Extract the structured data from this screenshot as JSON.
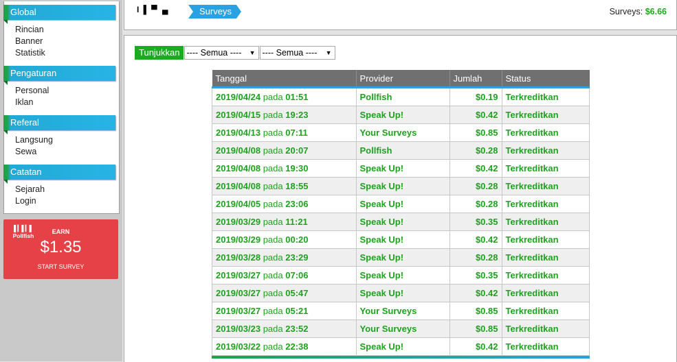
{
  "sidebar": {
    "groups": [
      {
        "title": "Global",
        "items": [
          "Rincian",
          "Banner",
          "Statistik"
        ]
      },
      {
        "title": "Pengaturan",
        "items": [
          "Personal",
          "Iklan"
        ]
      },
      {
        "title": "Referal",
        "items": [
          "Langsung",
          "Sewa"
        ]
      },
      {
        "title": "Catatan",
        "items": [
          "Sejarah",
          "Login"
        ]
      }
    ]
  },
  "ad": {
    "logo": "Pollfish",
    "earn": "EARN",
    "amount": "$1.35",
    "cta": "START SURVEY"
  },
  "breadcrumb": {
    "user": "I▐ ▀ ▄",
    "current": "Surveys"
  },
  "balance": {
    "label": "Surveys:",
    "value": "$6.66"
  },
  "filter": {
    "button": "Tunjukkan",
    "select1": "---- Semua ----",
    "select2": "---- Semua ----"
  },
  "table": {
    "headers": [
      "Tanggal",
      "Provider",
      "Jumlah",
      "Status"
    ],
    "pada": "pada",
    "rows": [
      {
        "date": "2019/04/24",
        "time": "01:51",
        "provider": "Pollfish",
        "amount": "$0.19",
        "status": "Terkreditkan"
      },
      {
        "date": "2019/04/15",
        "time": "19:23",
        "provider": "Speak Up!",
        "amount": "$0.42",
        "status": "Terkreditkan"
      },
      {
        "date": "2019/04/13",
        "time": "07:11",
        "provider": "Your Surveys",
        "amount": "$0.85",
        "status": "Terkreditkan"
      },
      {
        "date": "2019/04/08",
        "time": "20:07",
        "provider": "Pollfish",
        "amount": "$0.28",
        "status": "Terkreditkan"
      },
      {
        "date": "2019/04/08",
        "time": "19:30",
        "provider": "Speak Up!",
        "amount": "$0.42",
        "status": "Terkreditkan"
      },
      {
        "date": "2019/04/08",
        "time": "18:55",
        "provider": "Speak Up!",
        "amount": "$0.28",
        "status": "Terkreditkan"
      },
      {
        "date": "2019/04/05",
        "time": "23:06",
        "provider": "Speak Up!",
        "amount": "$0.28",
        "status": "Terkreditkan"
      },
      {
        "date": "2019/03/29",
        "time": "11:21",
        "provider": "Speak Up!",
        "amount": "$0.35",
        "status": "Terkreditkan"
      },
      {
        "date": "2019/03/29",
        "time": "00:20",
        "provider": "Speak Up!",
        "amount": "$0.42",
        "status": "Terkreditkan"
      },
      {
        "date": "2019/03/28",
        "time": "23:29",
        "provider": "Speak Up!",
        "amount": "$0.28",
        "status": "Terkreditkan"
      },
      {
        "date": "2019/03/27",
        "time": "07:06",
        "provider": "Speak Up!",
        "amount": "$0.35",
        "status": "Terkreditkan"
      },
      {
        "date": "2019/03/27",
        "time": "05:47",
        "provider": "Speak Up!",
        "amount": "$0.42",
        "status": "Terkreditkan"
      },
      {
        "date": "2019/03/27",
        "time": "05:21",
        "provider": "Your Surveys",
        "amount": "$0.85",
        "status": "Terkreditkan"
      },
      {
        "date": "2019/03/23",
        "time": "23:52",
        "provider": "Your Surveys",
        "amount": "$0.85",
        "status": "Terkreditkan"
      },
      {
        "date": "2019/03/22",
        "time": "22:38",
        "provider": "Speak Up!",
        "amount": "$0.42",
        "status": "Terkreditkan"
      }
    ]
  },
  "colors": {
    "accent_green": "#1ea91e",
    "accent_blue": "#2aa1e0",
    "ad_red": "#e54146"
  }
}
